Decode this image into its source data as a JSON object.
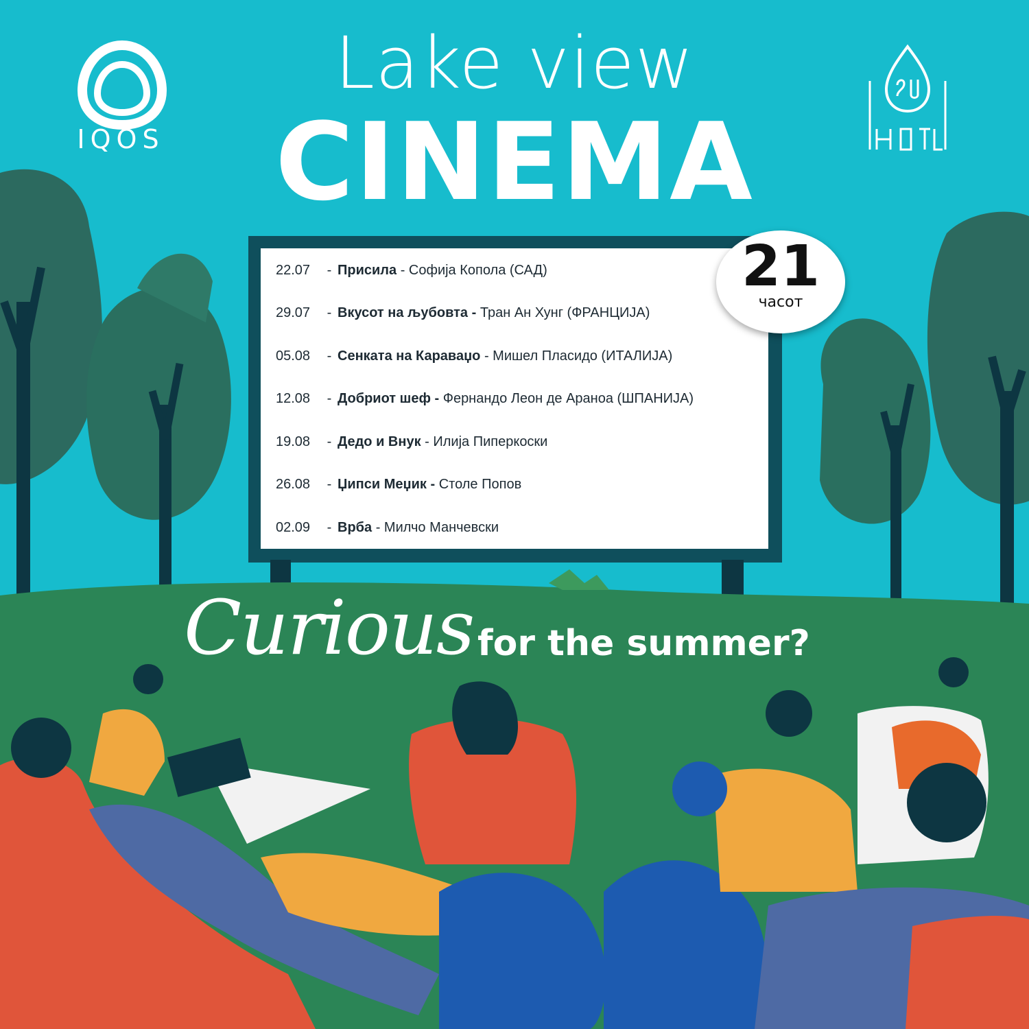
{
  "title": {
    "line1": "Lake view",
    "line2": "CINEMA"
  },
  "logos": {
    "left_brand": "IQOS",
    "right_brand": "hotel-logo"
  },
  "time_badge": {
    "number": "21",
    "label": "часот"
  },
  "schedule": [
    {
      "date": "22.07",
      "title": "Присила",
      "rest": "Софија Копола (САД)"
    },
    {
      "date": "29.07",
      "title": "Вкусот на љубовта",
      "rest": "Тран Ан Хунг (ФРАНЦИЈА)"
    },
    {
      "date": "05.08",
      "title": "Сенката на Караваџо",
      "rest": "Мишел Пласидо (ИТАЛИЈА)"
    },
    {
      "date": "12.08",
      "title": "Добриот шеф",
      "rest": "Фернандо Леон де Араноа (ШПАНИЈА)"
    },
    {
      "date": "19.08",
      "title": "Дедо и Внук",
      "rest": "Илија Пиперкоски"
    },
    {
      "date": "26.08",
      "title": "Џипси Меџик",
      "rest": "Столе Попов"
    },
    {
      "date": "02.09",
      "title": "Врба",
      "rest": "Милчо Манчевски"
    }
  ],
  "tagline": {
    "script": "Curious",
    "rest": "for the summer?"
  },
  "colors": {
    "sky": "#17bccd",
    "grass": "#2b8556",
    "tree": "#2e6f62",
    "screen_frame": "#0f4f5c",
    "accent_orange": "#e85b3a"
  }
}
